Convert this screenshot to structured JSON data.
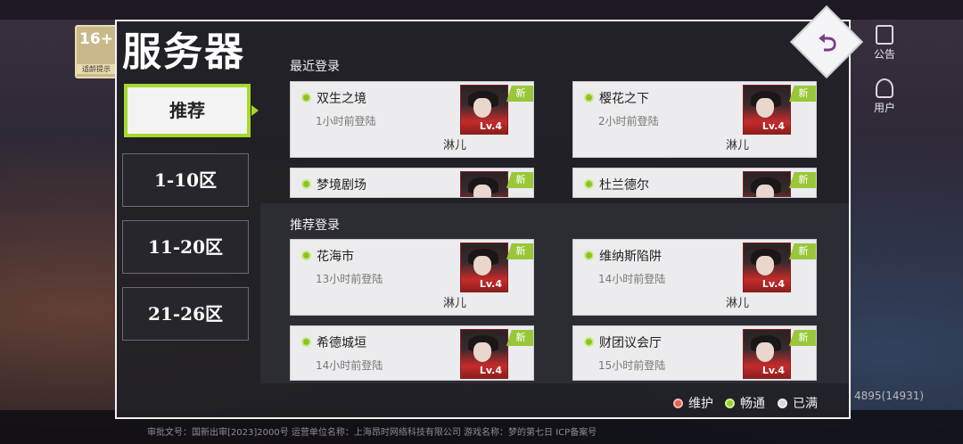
{
  "background": {
    "age_badge": {
      "number": "16+",
      "text": "适龄提示"
    },
    "footer_text": "审批文号：国新出审[2023]2000号    运营单位名称：上海昂时网络科技有限公司    游戏名称：梦的第七日  ICP备案号",
    "version": "4895(14931)",
    "side_buttons": [
      {
        "label": "公告",
        "icon": "notice-icon"
      },
      {
        "label": "用户",
        "icon": "user-icon"
      }
    ]
  },
  "panel": {
    "title": "服务器",
    "back_icon": "back-arrow-icon"
  },
  "tabs": [
    {
      "label": "推荐",
      "active": true
    },
    {
      "label": "1-10区",
      "active": false
    },
    {
      "label": "11-20区",
      "active": false
    },
    {
      "label": "21-26区",
      "active": false
    }
  ],
  "recent": {
    "title": "最近登录",
    "cards": [
      {
        "name": "双生之境",
        "time": "1小时前登陆",
        "user": "淋儿",
        "lv": "Lv.4",
        "badge": "新"
      },
      {
        "name": "樱花之下",
        "time": "2小时前登陆",
        "user": "淋儿",
        "lv": "Lv.4",
        "badge": "新"
      },
      {
        "name": "梦境剧场",
        "time": "",
        "user": "",
        "lv": "",
        "badge": "新"
      },
      {
        "name": "杜兰德尔",
        "time": "",
        "user": "",
        "lv": "",
        "badge": "新"
      }
    ]
  },
  "recommend": {
    "title": "推荐登录",
    "cards": [
      {
        "name": "花海市",
        "time": "13小时前登陆",
        "user": "淋儿",
        "lv": "Lv.4",
        "badge": "新"
      },
      {
        "name": "维纳斯陷阱",
        "time": "14小时前登陆",
        "user": "淋儿",
        "lv": "Lv.4",
        "badge": "新"
      },
      {
        "name": "希德城垣",
        "time": "14小时前登陆",
        "user": "",
        "lv": "Lv.4",
        "badge": "新"
      },
      {
        "name": "财团议会厅",
        "time": "15小时前登陆",
        "user": "",
        "lv": "Lv.4",
        "badge": "新"
      }
    ]
  },
  "legend": [
    {
      "label": "维护",
      "color": "#e8604e"
    },
    {
      "label": "畅通",
      "color": "#9bd12a"
    },
    {
      "label": "已满",
      "color": "#d8d8d8"
    }
  ],
  "colors": {
    "accent": "#a6d92b",
    "status_online": "#8ec21f"
  }
}
